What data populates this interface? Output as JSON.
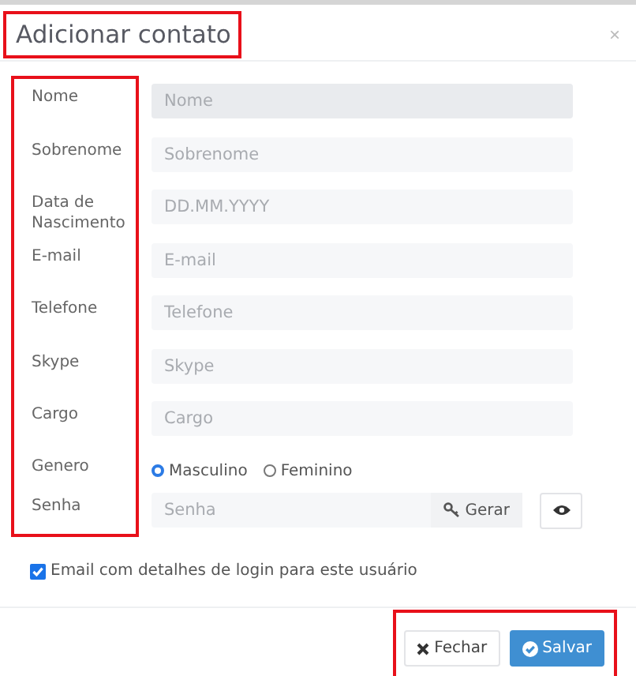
{
  "dialog": {
    "title": "Adicionar contato",
    "close": "×"
  },
  "fields": [
    {
      "kind": "text",
      "label": "Nome",
      "placeholder": "Nome",
      "disabled": true
    },
    {
      "kind": "text",
      "label": "Sobrenome",
      "placeholder": "Sobrenome",
      "disabled": false
    },
    {
      "kind": "text",
      "label": "Data de Nascimento",
      "placeholder": "DD.MM.YYYY",
      "disabled": false
    },
    {
      "kind": "text",
      "label": "E-mail",
      "placeholder": "E-mail",
      "disabled": false
    },
    {
      "kind": "text",
      "label": "Telefone",
      "placeholder": "Telefone",
      "disabled": false
    },
    {
      "kind": "text",
      "label": "Skype",
      "placeholder": "Skype",
      "disabled": false
    },
    {
      "kind": "text",
      "label": "Cargo",
      "placeholder": "Cargo",
      "disabled": false
    },
    {
      "kind": "radio",
      "label": "Genero",
      "options": [
        {
          "label": "Masculino",
          "selected": true
        },
        {
          "label": "Feminino",
          "selected": false
        }
      ]
    },
    {
      "kind": "password",
      "label": "Senha",
      "placeholder": "Senha",
      "generate": "Gerar"
    }
  ],
  "email_login": {
    "label": "Email com detalhes de login para este usuário",
    "checked": true
  },
  "buttons": [
    {
      "kind": "close",
      "label": "Fechar"
    },
    {
      "kind": "save",
      "label": "Salvar"
    }
  ]
}
